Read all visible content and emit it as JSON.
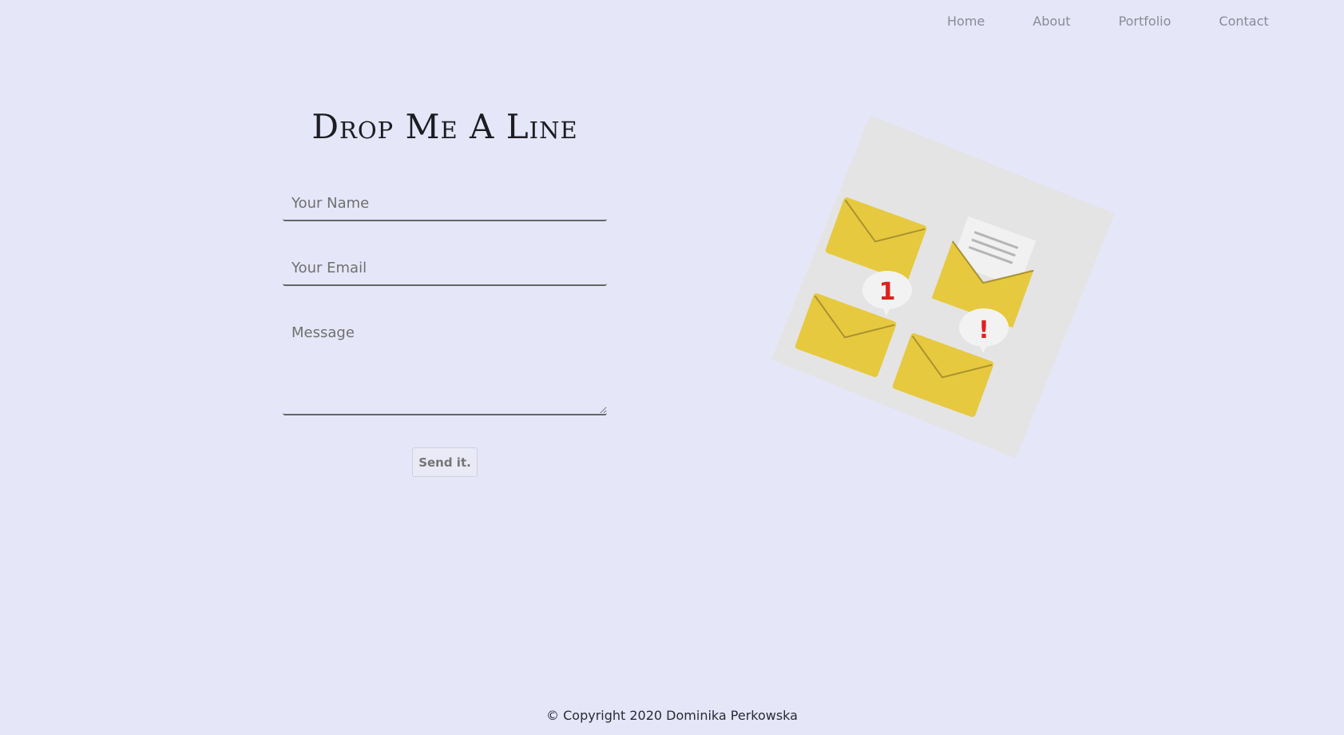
{
  "nav": {
    "items": [
      {
        "label": "Home"
      },
      {
        "label": "About"
      },
      {
        "label": "Portfolio"
      },
      {
        "label": "Contact"
      }
    ]
  },
  "form": {
    "title": "Drop Me A Line",
    "name_placeholder": "Your Name",
    "email_placeholder": "Your Email",
    "message_placeholder": "Message",
    "send_label": "Send it."
  },
  "illustration": {
    "icon": "envelopes-illustration",
    "badges": [
      "1",
      "!"
    ],
    "colors": {
      "card": "#e4e4e4",
      "envelope": "#e6c93f",
      "envelope_shade": "#a99230",
      "badge_mark": "#e02020"
    }
  },
  "footer": {
    "copyright": "© Copyright 2020 Dominika Perkowska"
  },
  "colors": {
    "background": "#e5e6f8",
    "nav_text": "#8a8b95",
    "title_text": "#1c1c22"
  }
}
